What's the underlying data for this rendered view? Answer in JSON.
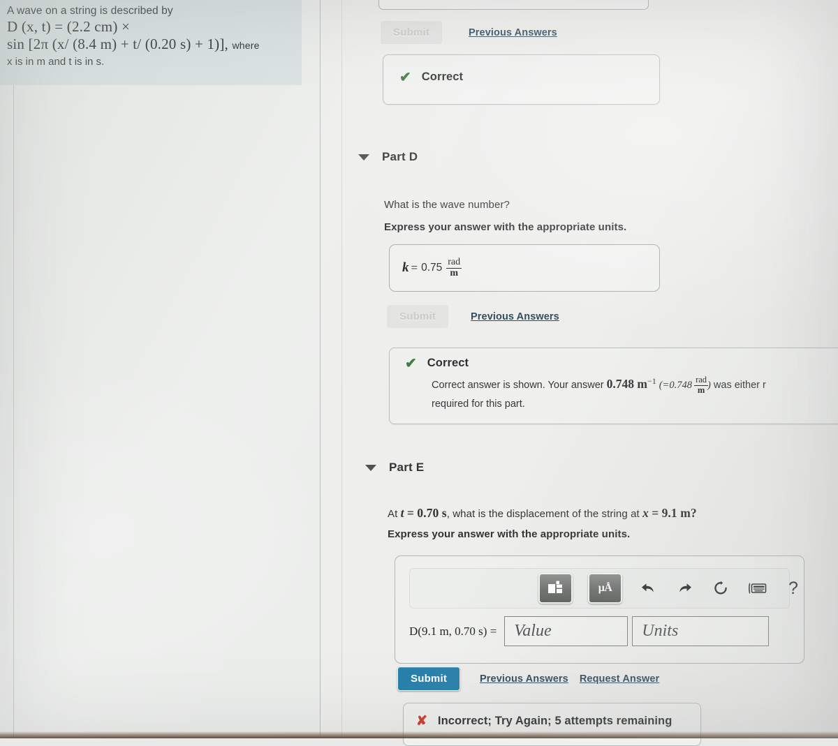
{
  "question_panel": {
    "intro": "A wave on a string is described by",
    "formula_line1": "D (x, t) = (2.2 cm) ×",
    "formula_line2": "sin [2π (x/ (8.4 m) + t/ (0.20 s) + 1)],",
    "where_word": "where",
    "units_line": "x is in m and t is in s."
  },
  "part_c": {
    "submit_label": "Submit",
    "previous_answers_label": "Previous Answers",
    "feedback": {
      "icon": "check-icon",
      "title": "Correct"
    }
  },
  "part_d": {
    "title": "Part D",
    "caret": "chevron-down-icon",
    "prompt": "What is the wave number?",
    "instruction": "Express your answer with the appropriate units.",
    "answer": {
      "symbol": "k",
      "equals": "=",
      "value": "0.75",
      "unit_numerator": "rad",
      "unit_denominator": "m"
    },
    "submit_label": "Submit",
    "previous_answers_label": "Previous Answers",
    "feedback": {
      "icon": "check-icon",
      "title": "Correct",
      "body_prefix": "Correct answer is shown. Your answer",
      "body_value": "0.748 m",
      "body_exponent": "−1",
      "body_paren_open": "(=0.748",
      "body_unit_numerator": "rad",
      "body_unit_denominator": "m",
      "body_paren_close": ")",
      "body_suffix": "was either r",
      "body_line2": "required for this part."
    }
  },
  "part_e": {
    "title": "Part E",
    "caret": "chevron-down-icon",
    "prompt_prefix": "At",
    "prompt_t": "t",
    "prompt_eq1": "=",
    "prompt_t_value": "0.70 s",
    "prompt_middle": ", what is the displacement of the string at",
    "prompt_x": "x",
    "prompt_eq2": "=",
    "prompt_x_value": "9.1 m",
    "prompt_suffix": "?",
    "instruction": "Express your answer with the appropriate units.",
    "toolbar": [
      {
        "name": "math-template-icon",
        "glyph": "template"
      },
      {
        "name": "units-micro-angstrom-icon",
        "glyph": "μÅ"
      },
      {
        "name": "undo-icon",
        "glyph": "↶"
      },
      {
        "name": "redo-icon",
        "glyph": "↷"
      },
      {
        "name": "reset-icon",
        "glyph": "↺"
      },
      {
        "name": "keyboard-icon",
        "glyph": "keyboard"
      },
      {
        "name": "help-icon",
        "glyph": "?"
      }
    ],
    "answer_label": "D(9.1 m, 0.70 s) =",
    "value_placeholder": "Value",
    "units_placeholder": "Units",
    "submit_label": "Submit",
    "previous_answers_label": "Previous Answers",
    "request_answer_label": "Request Answer",
    "feedback": {
      "icon": "cross-icon",
      "message": "Incorrect; Try Again; 5 attempts remaining"
    }
  },
  "colors": {
    "submit_active": "#2781ab",
    "link": "#2f4b5c",
    "correct_green": "#3b7a3f",
    "incorrect_red": "#cf3b2b",
    "question_panel_bg": "#d7e3e2",
    "page_bg": "#eeeeec"
  }
}
